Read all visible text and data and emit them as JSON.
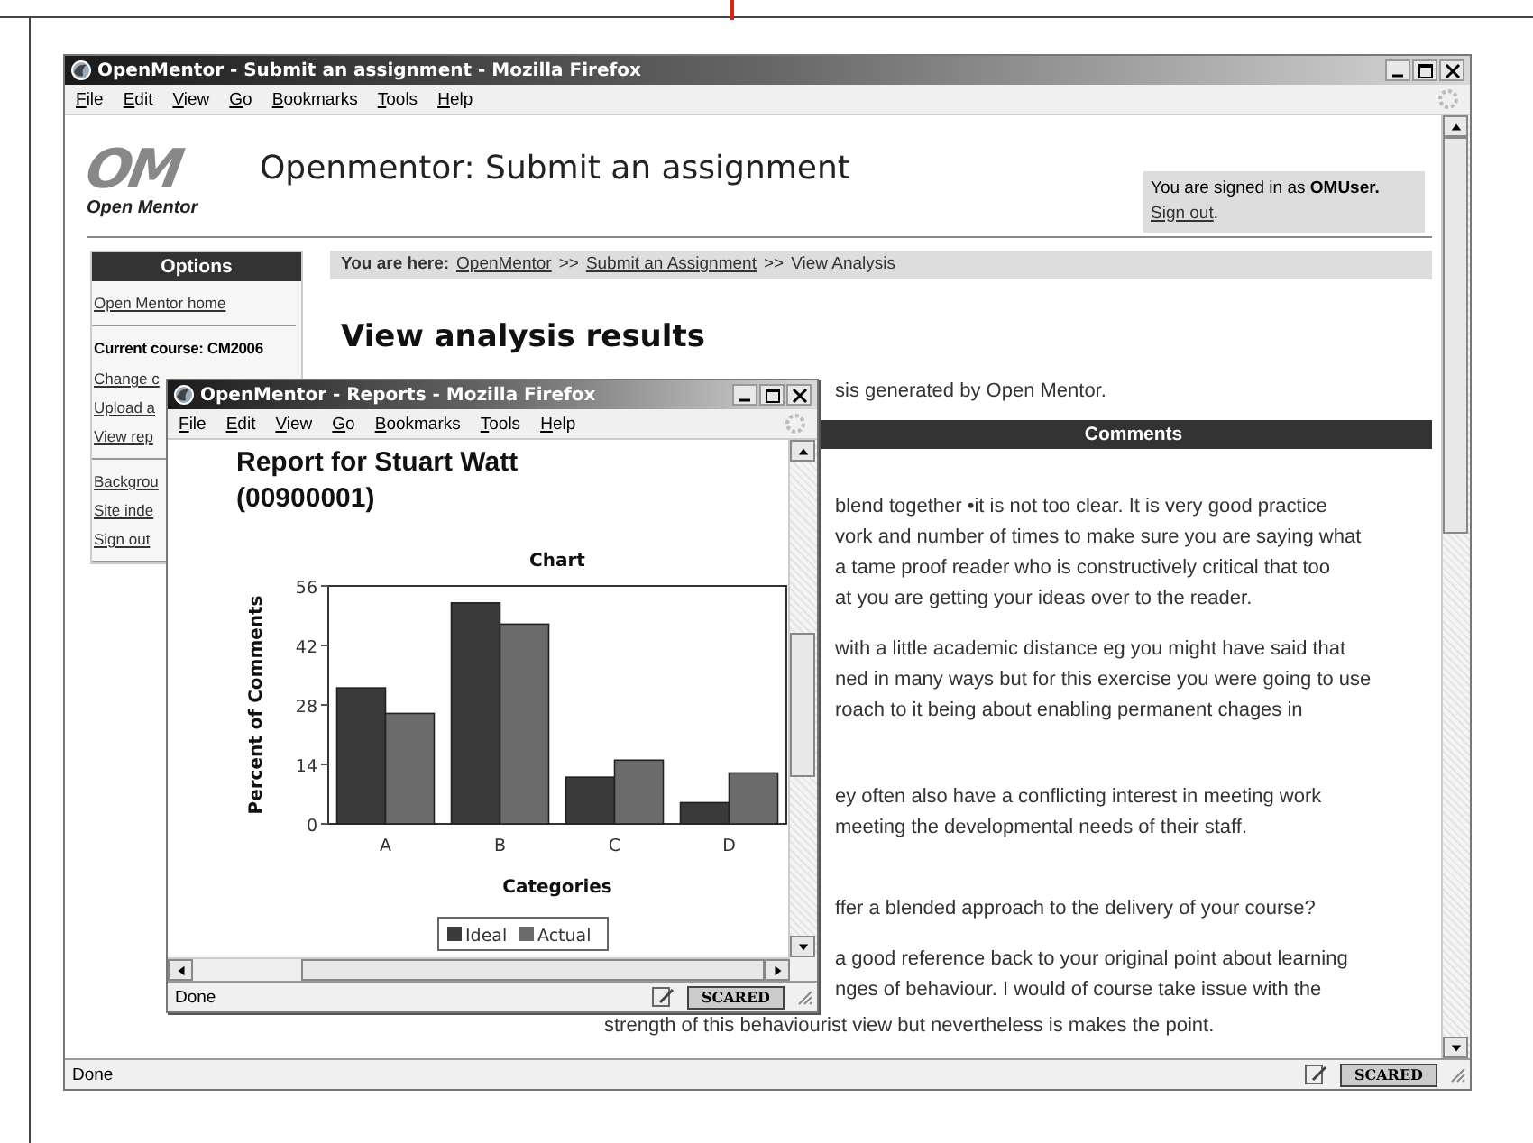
{
  "window": {
    "title": "OpenMentor - Submit an assignment - Mozilla Firefox",
    "menu": [
      "File",
      "Edit",
      "View",
      "Go",
      "Bookmarks",
      "Tools",
      "Help"
    ],
    "status": "Done",
    "badge": "SCARED"
  },
  "header": {
    "logo_mark": "OM",
    "logo_name": "Open Mentor",
    "title": "Openmentor: Submit an assignment",
    "signed_in": "You are signed in as **OMUser.**",
    "sign_out": "Sign out",
    "sign_out_end": "."
  },
  "breadcrumb": {
    "label": "You are here:",
    "trail": [
      {
        "text": "OpenMentor",
        "kind": "link"
      },
      {
        "text": ">>",
        "kind": "separator"
      },
      {
        "text": "Submit an Assignment",
        "kind": "link"
      },
      {
        "text": ">>",
        "kind": "separator"
      },
      {
        "text": "View Analysis",
        "kind": "current"
      }
    ]
  },
  "sidebar": {
    "title": "Options",
    "sections": [
      [
        {
          "text": "Open Mentor home",
          "kind": "link"
        }
      ],
      [
        {
          "text": "Current course: CM2006",
          "kind": "heading"
        },
        {
          "text": "Change c",
          "kind": "link"
        },
        {
          "text": "Upload a",
          "kind": "link"
        },
        {
          "text": "View rep",
          "kind": "link"
        }
      ],
      [
        {
          "text": "Backgrou",
          "kind": "link"
        },
        {
          "text": "Site inde",
          "kind": "link"
        },
        {
          "text": "Sign out",
          "kind": "link"
        }
      ]
    ]
  },
  "main": {
    "heading": "View analysis results",
    "intro": "sis generated by Open Mentor.",
    "comments_title": "Comments",
    "paragraphs": [
      [
        "blend together •it is not too clear. It is very good practice",
        "vork and number of times to make sure you are saying what",
        "a tame proof reader who is constructively critical that too",
        "at you are getting your ideas over to the reader."
      ],
      [
        "with a little academic distance eg you might have said that",
        "ned in many ways but for this exercise you were going to use",
        "roach to it being about enabling permanent chages in"
      ],
      [
        "ey often also have a conflicting interest in meeting work",
        "meeting the developmental needs of their staff."
      ],
      [
        "ffer a blended approach to the delivery of your course?"
      ],
      [
        "a good reference back to your original point about learning",
        "nges of behaviour. I would of course take issue with the"
      ]
    ],
    "closing_line": "strength of this behaviourist view but nevertheless is makes the point."
  },
  "popup": {
    "title": "OpenMentor - Reports - Mozilla Firefox",
    "menu": [
      "File",
      "Edit",
      "View",
      "Go",
      "Bookmarks",
      "Tools",
      "Help"
    ],
    "report_title": "Report for Stuart Watt",
    "report_id": "(00900001)",
    "status": "Done",
    "badge": "SCARED",
    "chart_data": {
      "type": "bar",
      "title": "Chart",
      "xlabel": "Categories",
      "ylabel": "Percent of Comments",
      "categories": [
        "A",
        "B",
        "C",
        "D"
      ],
      "series": [
        {
          "name": "Ideal",
          "color": "#3a3a3a",
          "values": [
            32,
            52,
            11,
            5
          ]
        },
        {
          "name": "Actual",
          "color": "#6b6b6b",
          "values": [
            26,
            47,
            15,
            12
          ]
        }
      ],
      "ylim": [
        0,
        56
      ],
      "yticks": [
        0,
        14,
        28,
        42,
        56
      ],
      "legend": "bottom"
    }
  }
}
